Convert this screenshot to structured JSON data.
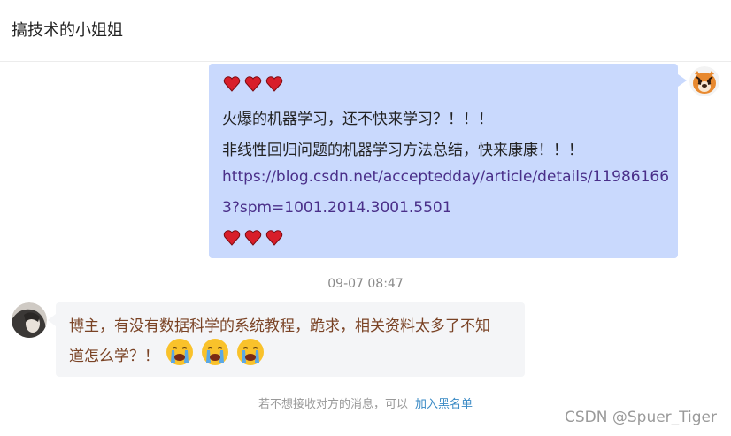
{
  "header": {
    "title": "搞技术的小姐姐"
  },
  "messages": {
    "outgoing": {
      "line1": "火爆的机器学习，还不快来学习？！！！",
      "line2": "非线性回归问题的机器学习方法总结，快来康康！！！",
      "link_part1": "https://blog.csdn.net/acceptedday/article/details/11986166",
      "link_part2": "3?spm=1001.2014.3001.5501",
      "avatar_icon": "tiger-avatar",
      "hearts_icon": "heart-emoji"
    },
    "timestamp": "09-07 08:47",
    "incoming": {
      "line1": "博主，有没有数据科学的系统教程，跪求，相关资料太多了不知",
      "line2": "道怎么学？！",
      "emoji_icon": "crying-face-emoji",
      "avatar_icon": "user-avatar"
    }
  },
  "footer": {
    "notice_text": "若不想接收对方的消息，可以",
    "block_link": "加入黑名单"
  },
  "watermark": "CSDN @Spuer_Tiger",
  "colors": {
    "outgoing_bubble": "#c9d9fd",
    "incoming_bubble": "#f4f5f7",
    "link_color": "#4a2f89",
    "block_link_color": "#3a8ac5"
  }
}
